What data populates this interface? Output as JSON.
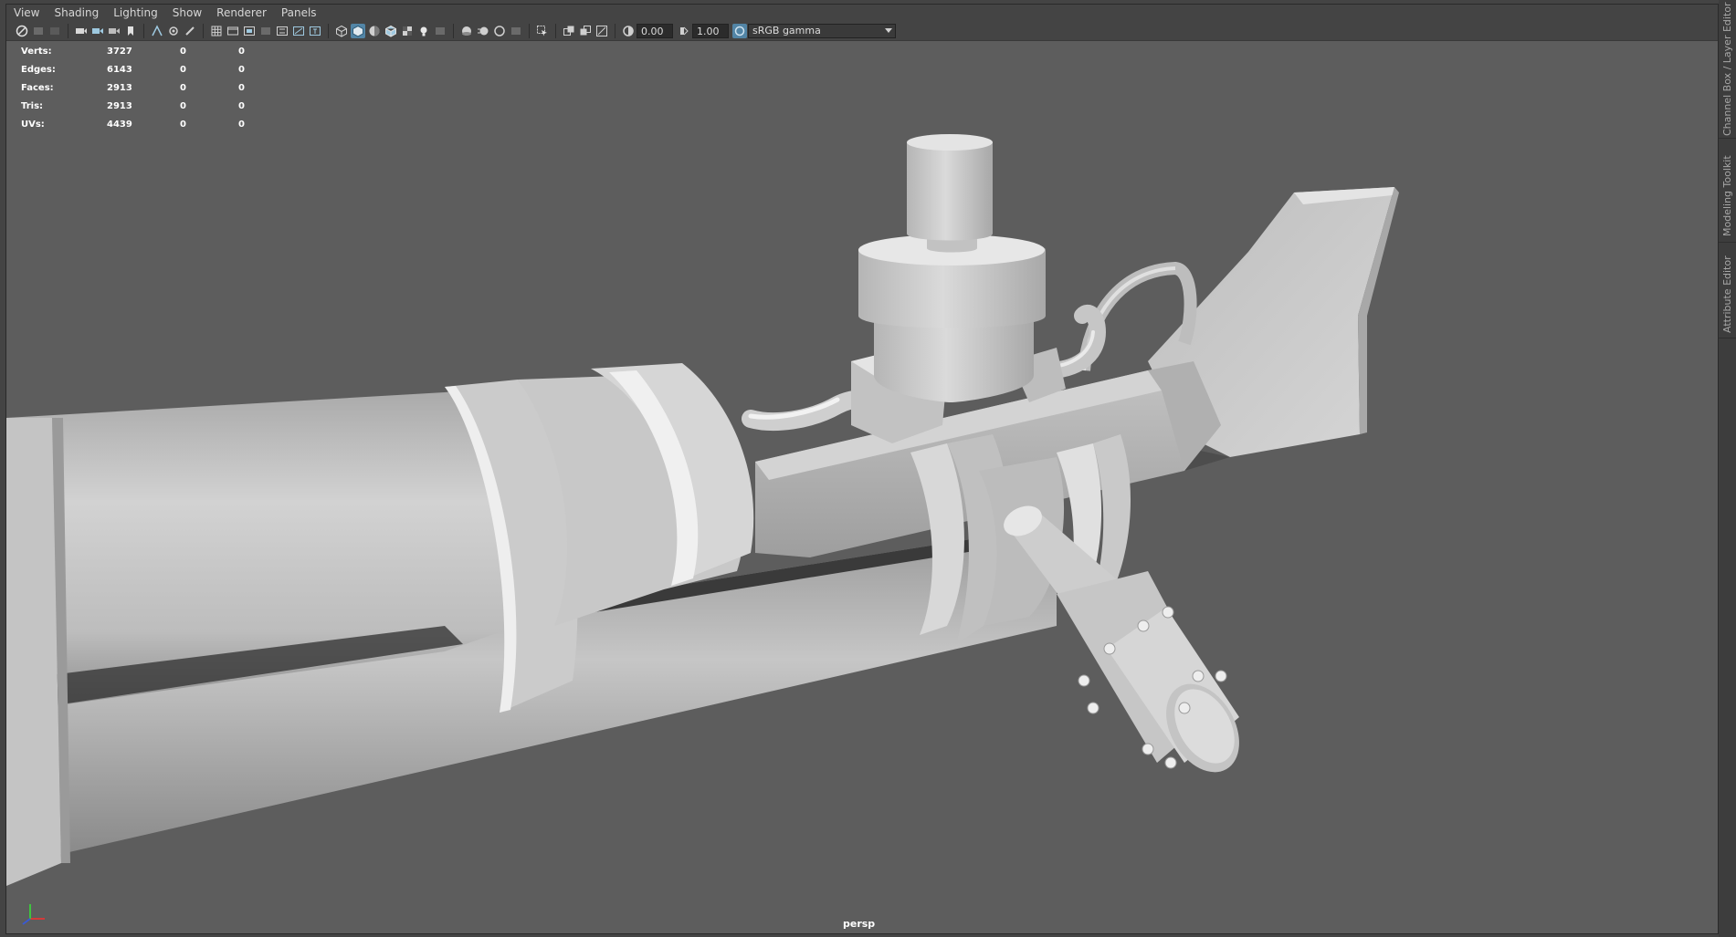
{
  "menubar": {
    "items": [
      "View",
      "Shading",
      "Lighting",
      "Show",
      "Renderer",
      "Panels"
    ]
  },
  "toolbar": {
    "exposure_value": "0.00",
    "gamma_value": "1.00",
    "color_space": "sRGB gamma",
    "icons": [
      "select-camera-icon",
      "camera-attributes-icon",
      "bookmark-icon",
      "image-plane-icon",
      "two-d-pan-icon",
      "grease-pencil-icon",
      "grid-icon",
      "film-gate-icon",
      "resolution-gate-icon",
      "gate-mask-icon",
      "field-chart-icon",
      "safe-action-icon",
      "safe-title-icon",
      "wireframe-icon",
      "smooth-shade-icon",
      "use-default-material-icon",
      "wireframe-on-shaded-icon",
      "textured-icon",
      "use-all-lights-icon",
      "shadows-icon",
      "screen-space-ao-icon",
      "motion-blur-icon",
      "multisample-aa-icon",
      "depth-of-field-icon",
      "isolate-select-icon",
      "xray-icon",
      "xray-active-components-icon",
      "xray-joints-icon",
      "exposure-icon",
      "gamma-icon",
      "color-management-icon",
      "dropdown-arrow-icon"
    ]
  },
  "hud": {
    "rows": [
      {
        "label": "Verts:",
        "v1": "3727",
        "v2": "0",
        "v3": "0"
      },
      {
        "label": "Edges:",
        "v1": "6143",
        "v2": "0",
        "v3": "0"
      },
      {
        "label": "Faces:",
        "v1": "2913",
        "v2": "0",
        "v3": "0"
      },
      {
        "label": "Tris:",
        "v1": "2913",
        "v2": "0",
        "v3": "0"
      },
      {
        "label": "UVs:",
        "v1": "4439",
        "v2": "0",
        "v3": "0"
      }
    ]
  },
  "viewport": {
    "camera": "persp",
    "background_color": "#5d5d5d",
    "model_color": "#c8c8c8"
  },
  "side_tabs": [
    "Channel Box / Layer Editor",
    "Modeling Toolkit",
    "Attribute Editor"
  ]
}
